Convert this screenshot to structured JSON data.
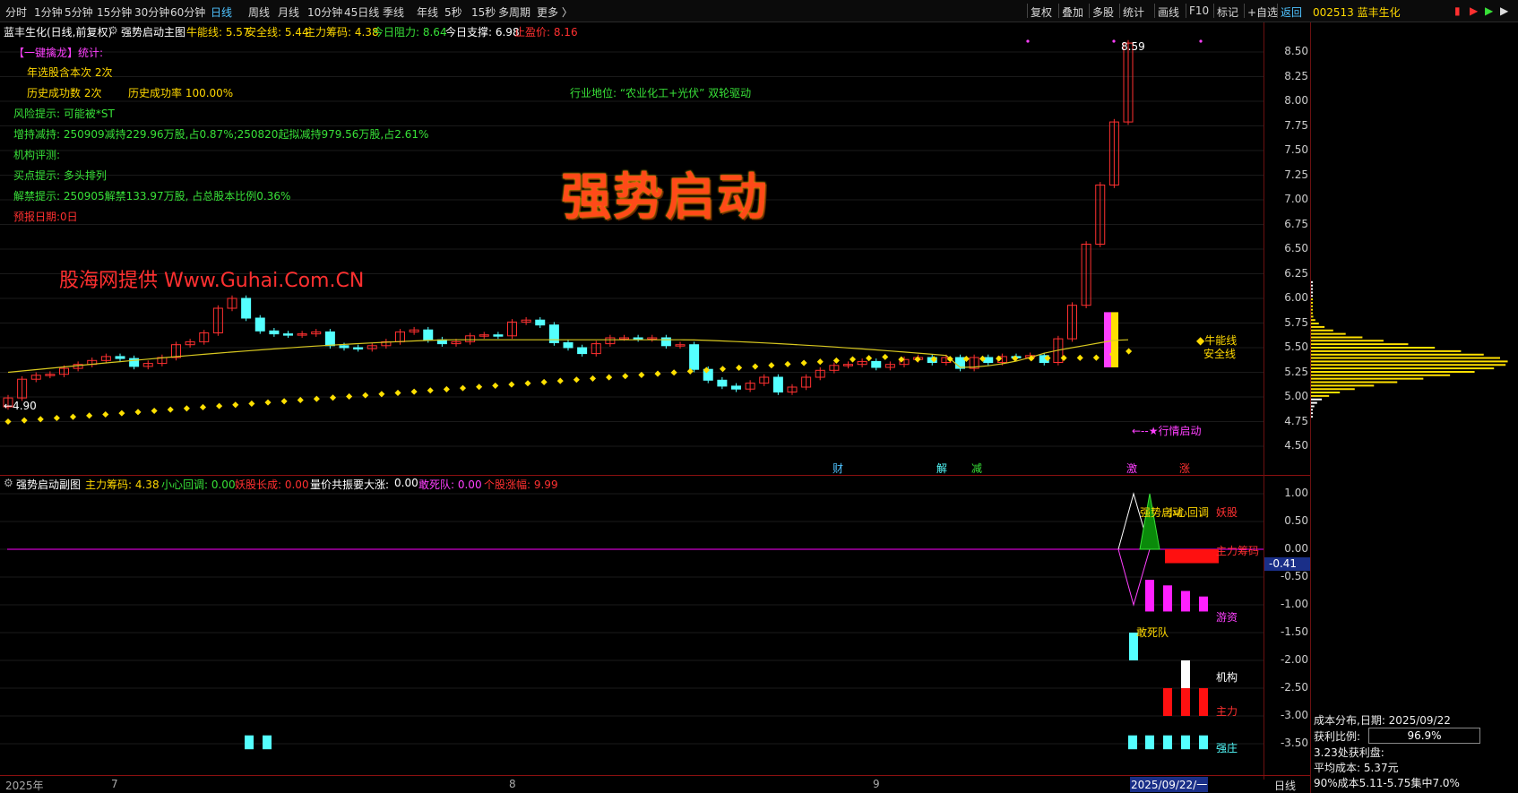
{
  "menu": {
    "left_items": [
      "分时",
      "1分钟",
      "5分钟",
      "15分钟",
      "30分钟",
      "60分钟",
      "日线",
      "周线",
      "月线",
      "10分钟",
      "45日线",
      "季线",
      "年线",
      "5秒",
      "15秒",
      "多周期",
      "更多 〉"
    ],
    "active": "日线",
    "right_items": [
      "复权",
      "叠加",
      "多股",
      "统计",
      "画线",
      "F10",
      "标记",
      "+自选",
      "返回"
    ],
    "stock": "002513 蓝丰生化"
  },
  "main": {
    "title": "蓝丰生化(日线,前复权)",
    "indicator_name": "强势启动主图",
    "bull_label": "牛能线: 5.57",
    "safe_label": "安全线: 5.44",
    "chip_label": "主力筹码: 4.38",
    "resist_label": "今日阻力: 8.64",
    "support_label": "今日支撑: 6.98",
    "stop_label": "止盈价: 8.16",
    "yaxis": [
      "8.50",
      "8.25",
      "8.00",
      "7.75",
      "7.50",
      "7.25",
      "7.00",
      "6.75",
      "6.50",
      "6.25",
      "6.00",
      "5.75",
      "5.50",
      "5.25",
      "5.00",
      "4.75",
      "4.50"
    ],
    "banner": "强势启动",
    "watermark": "股海网提供 Www.Guhai.Com.CN",
    "price_high_label": "8.59",
    "price_low_label": "←4.90",
    "bull_line_label": "◆牛能线",
    "safe_line_label": "安全线",
    "launch_label": "←--★行情启动",
    "events": [
      "财",
      "解",
      "减",
      "激",
      "涨"
    ]
  },
  "stats": {
    "header": "【一键擒龙】统计:",
    "year_pick": "年选股含本次 2次",
    "success_count": "历史成功数 2次",
    "success_rate": "历史成功率 100.00%",
    "industry": "行业地位: “农业化工+光伏” 双轮驱动",
    "risk": "风险提示: 可能被*ST",
    "holding": "增持减持: 250909减持229.96万股,占0.87%;250820起拟减持979.56万股,占2.61%",
    "rating": "机构评测:",
    "buy_point": "买点提示: 多头排列",
    "unlock": "解禁提示: 250905解禁133.97万股, 占总股本比例0.36%",
    "report": "预报日期:0日"
  },
  "sub": {
    "indicator_name": "强势启动副图",
    "chip": "主力筹码: 4.38",
    "pullback": "小心回调: 0.00",
    "demon": "妖股长成: 0.00",
    "resonance_label": "量价共振要大涨:",
    "resonance_value": "0.00",
    "dare": "敢死队: 0.00",
    "limit": "个股涨幅: 9.99",
    "yaxis": [
      "1.00",
      "0.50",
      "0.00",
      "-0.50",
      "-1.00",
      "-1.50",
      "-2.00",
      "-2.50",
      "-3.00",
      "-3.50"
    ],
    "current_value": "-0.41",
    "labels": {
      "strong_launch": "强势启动",
      "pullback": "小心回调",
      "demon": "妖股",
      "chip": "主力筹码",
      "hot_money": "游资",
      "dare_team": "敢死队",
      "institution": "机构",
      "main": "主力",
      "strong_banker": "强庄"
    }
  },
  "xaxis": {
    "labels": [
      "2025年",
      "7",
      "8",
      "9"
    ],
    "current": "2025/09/22/一",
    "period": "日线"
  },
  "cost": {
    "title": "成本分布,日期: 2025/09/22",
    "profit_label": "获利比例:",
    "profit_value": "96.9%",
    "profit_chip": "3.23处获利盘:",
    "avg_cost": "平均成本: 5.37元",
    "concentration": "90%成本5.11-5.75集中7.0%"
  },
  "colors": {
    "up": "#ff3030",
    "down": "#54ffff",
    "bull_line": "#ffd800",
    "accent_blue": "#4fc3ff",
    "magenta": "#ff00ff"
  }
}
